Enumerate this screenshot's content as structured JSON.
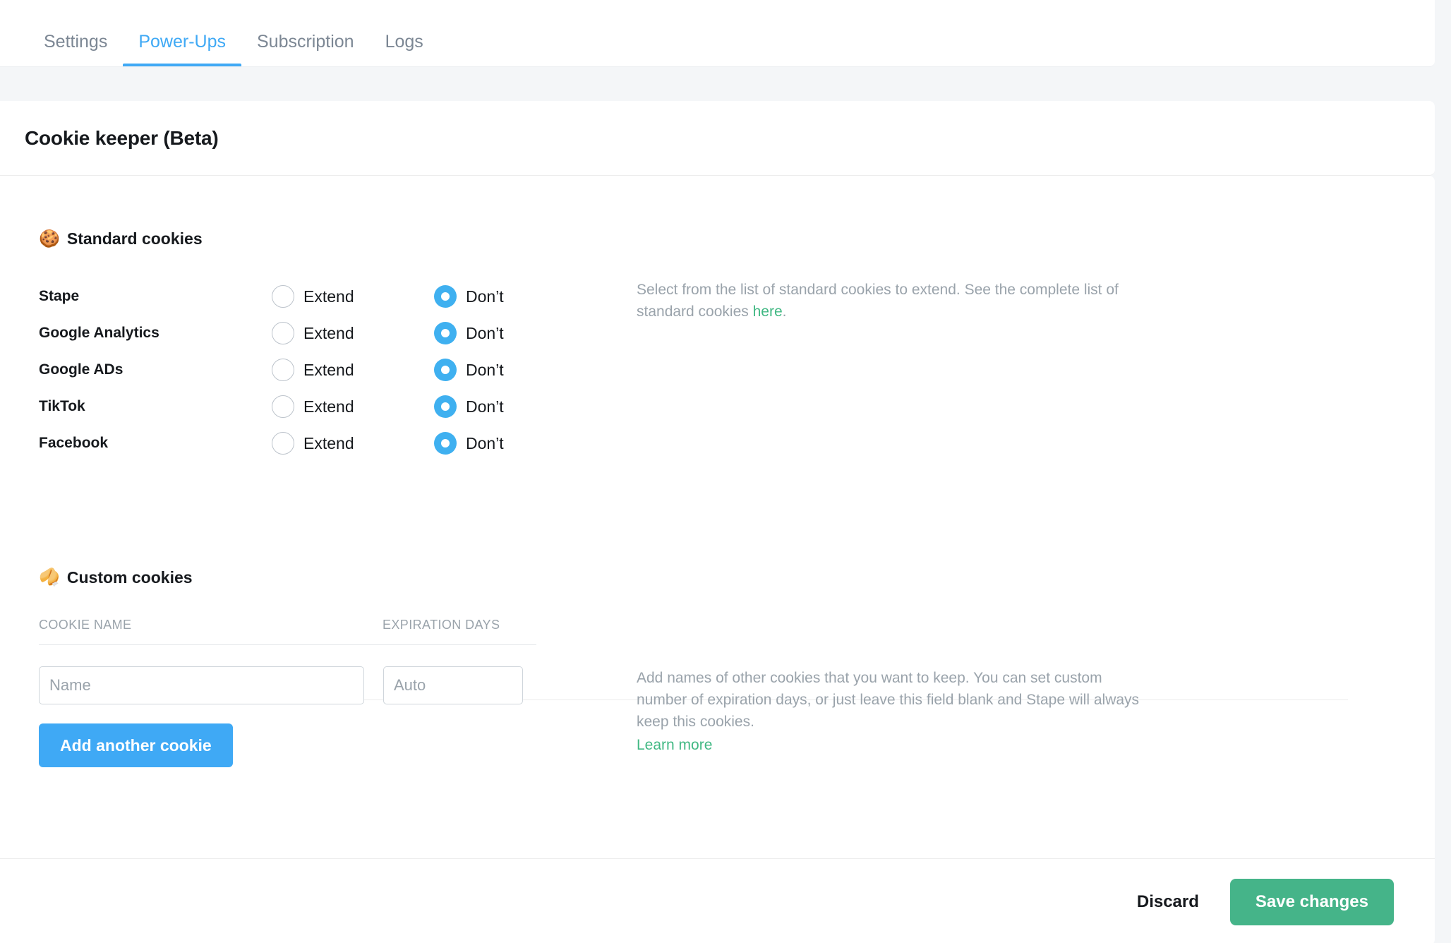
{
  "tabs": [
    {
      "label": "Settings",
      "active": false
    },
    {
      "label": "Power-Ups",
      "active": true
    },
    {
      "label": "Subscription",
      "active": false
    },
    {
      "label": "Logs",
      "active": false
    }
  ],
  "header": {
    "title": "Cookie keeper (Beta)"
  },
  "standard_section": {
    "emoji": "🍪",
    "heading": "Standard cookies",
    "option_extend_label": "Extend",
    "option_dont_label": "Don’t",
    "rows": [
      {
        "name": "Stape",
        "selected": "dont"
      },
      {
        "name": "Google Analytics",
        "selected": "dont"
      },
      {
        "name": "Google ADs",
        "selected": "dont"
      },
      {
        "name": "TikTok",
        "selected": "dont"
      },
      {
        "name": "Facebook",
        "selected": "dont"
      }
    ],
    "help_text_part1": "Select from the list of standard cookies to extend. See the complete list of standard cookies ",
    "help_link": "here",
    "help_text_part2": "."
  },
  "custom_section": {
    "emoji": "🥠",
    "heading": "Custom cookies",
    "col_name": "COOKIE NAME",
    "col_days": "EXPIRATION DAYS",
    "input_name_value": "",
    "input_name_placeholder": "Name",
    "input_days_value": "",
    "input_days_placeholder": "Auto",
    "add_button": "Add another cookie",
    "help_text": "Add names of other cookies that you want to keep. You can set custom number of expiration days, or just leave this field blank and Stape will always keep this cookies.",
    "learn_more": "Learn more"
  },
  "footer": {
    "discard": "Discard",
    "save": "Save changes"
  },
  "colors": {
    "accent_blue": "#3fa9f5",
    "radio_blue": "#3fb0f0",
    "link_green": "#41b883",
    "save_green": "#45b489",
    "page_bg": "#f4f6f8"
  }
}
